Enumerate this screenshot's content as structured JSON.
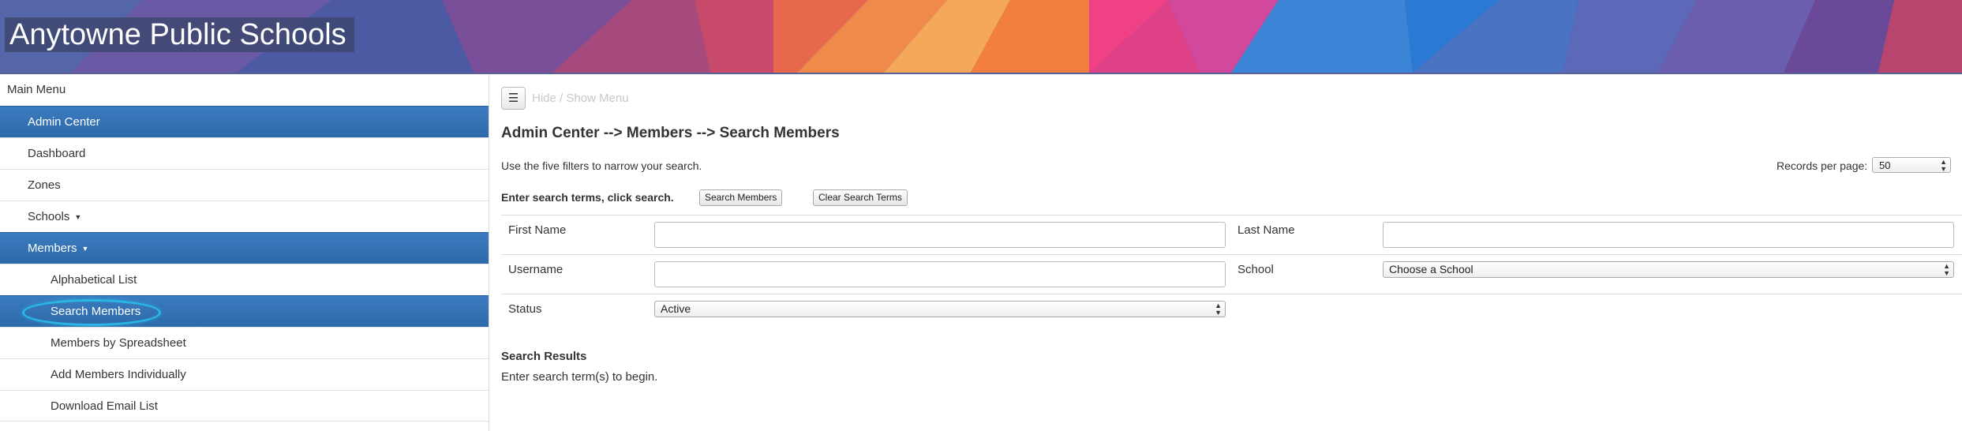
{
  "header": {
    "school_name": "Anytowne Public Schools"
  },
  "sidebar": {
    "heading": "Main Menu",
    "items": [
      {
        "label": "Admin Center",
        "active": true
      },
      {
        "label": "Dashboard",
        "active": false
      },
      {
        "label": "Zones",
        "active": false
      },
      {
        "label": "Schools",
        "active": false,
        "dropdown": true
      },
      {
        "label": "Members",
        "active": true,
        "dropdown": true
      },
      {
        "label": "Alphabetical List",
        "active": false
      },
      {
        "label": "Search Members",
        "active": true,
        "highlighted": true
      },
      {
        "label": "Members by Spreadsheet",
        "active": false
      },
      {
        "label": "Add Members Individually",
        "active": false
      },
      {
        "label": "Download Email List",
        "active": false
      }
    ]
  },
  "main": {
    "toggle_icon": "hamburger-icon",
    "toggle_label": "Hide / Show Menu",
    "breadcrumb_title": "Admin Center --> Members --> Search Members",
    "instructions": "Use the five filters to narrow your search.",
    "records_per_page_label": "Records per page:",
    "records_per_page_value": "50",
    "search_terms_label": "Enter search terms, click search.",
    "search_button": "Search Members",
    "clear_button": "Clear Search Terms",
    "filters": {
      "first_name_label": "First Name",
      "first_name_value": "",
      "last_name_label": "Last Name",
      "last_name_value": "",
      "username_label": "Username",
      "username_value": "",
      "school_label": "School",
      "school_value": "Choose a School",
      "status_label": "Status",
      "status_value": "Active"
    },
    "results_heading": "Search Results",
    "results_text": "Enter search term(s) to begin."
  },
  "colors": {
    "active_menu": "#3272b3",
    "highlight_ring": "#29b6e6"
  }
}
